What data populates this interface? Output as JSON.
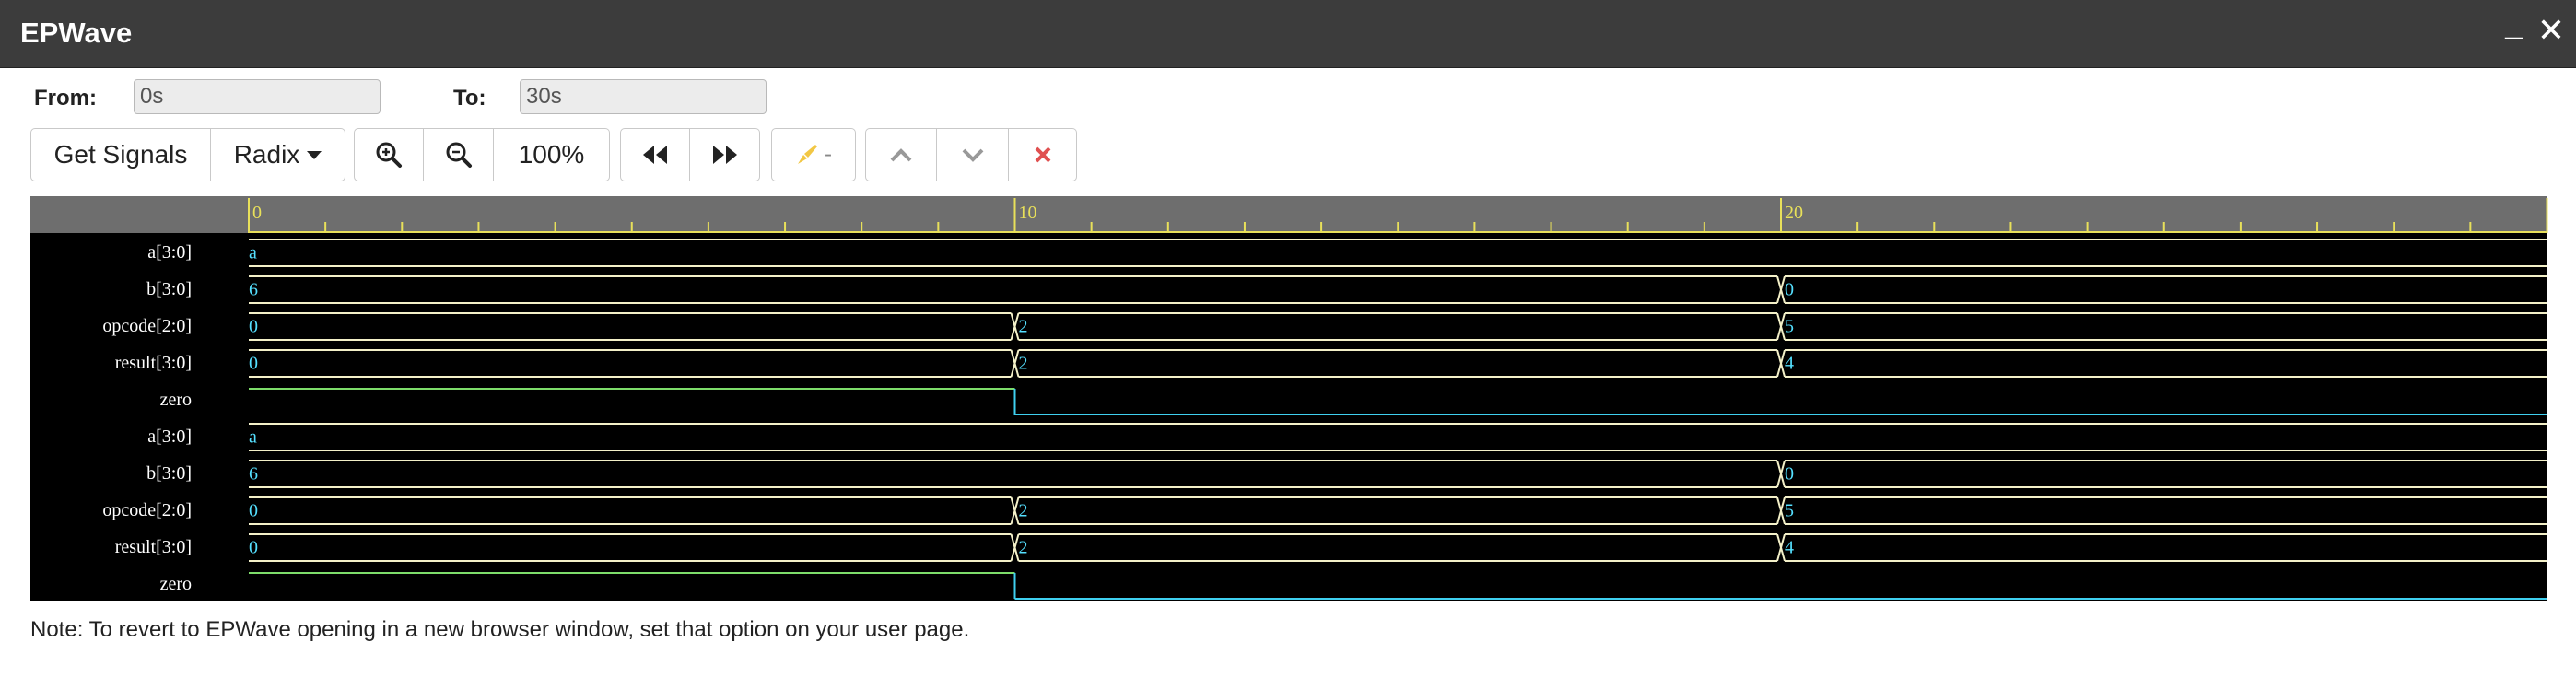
{
  "window": {
    "title": "EPWave",
    "minimize_glyph": "_",
    "close_glyph": "✕"
  },
  "range": {
    "from_label": "From:",
    "from_value": "0s",
    "to_label": "To:",
    "to_value": "30s"
  },
  "toolbar": {
    "get_signals_label": "Get Signals",
    "radix_label": "Radix",
    "zoom_level": "100%",
    "highlight_label": "-"
  },
  "ruler": {
    "labels": [
      "0",
      "10",
      "20"
    ]
  },
  "signals": [
    {
      "name": "a[3:0]",
      "type": "bus",
      "segments": [
        {
          "t0": 0,
          "t1": 30,
          "v": "a"
        }
      ]
    },
    {
      "name": "b[3:0]",
      "type": "bus",
      "segments": [
        {
          "t0": 0,
          "t1": 20,
          "v": "6"
        },
        {
          "t0": 20,
          "t1": 30,
          "v": "0"
        }
      ]
    },
    {
      "name": "opcode[2:0]",
      "type": "bus",
      "segments": [
        {
          "t0": 0,
          "t1": 10,
          "v": "0"
        },
        {
          "t0": 10,
          "t1": 20,
          "v": "2"
        },
        {
          "t0": 20,
          "t1": 30,
          "v": "5"
        }
      ]
    },
    {
      "name": "result[3:0]",
      "type": "bus",
      "segments": [
        {
          "t0": 0,
          "t1": 10,
          "v": "0"
        },
        {
          "t0": 10,
          "t1": 20,
          "v": "2"
        },
        {
          "t0": 20,
          "t1": 30,
          "v": "4"
        }
      ]
    },
    {
      "name": "zero",
      "type": "bit",
      "transitions": [
        {
          "t": 0,
          "v": 1
        },
        {
          "t": 10,
          "v": 0
        }
      ]
    },
    {
      "name": "a[3:0]",
      "type": "bus",
      "segments": [
        {
          "t0": 0,
          "t1": 30,
          "v": "a"
        }
      ]
    },
    {
      "name": "b[3:0]",
      "type": "bus",
      "segments": [
        {
          "t0": 0,
          "t1": 20,
          "v": "6"
        },
        {
          "t0": 20,
          "t1": 30,
          "v": "0"
        }
      ]
    },
    {
      "name": "opcode[2:0]",
      "type": "bus",
      "segments": [
        {
          "t0": 0,
          "t1": 10,
          "v": "0"
        },
        {
          "t0": 10,
          "t1": 20,
          "v": "2"
        },
        {
          "t0": 20,
          "t1": 30,
          "v": "5"
        }
      ]
    },
    {
      "name": "result[3:0]",
      "type": "bus",
      "segments": [
        {
          "t0": 0,
          "t1": 10,
          "v": "0"
        },
        {
          "t0": 10,
          "t1": 20,
          "v": "2"
        },
        {
          "t0": 20,
          "t1": 30,
          "v": "4"
        }
      ]
    },
    {
      "name": "zero",
      "type": "bit",
      "transitions": [
        {
          "t": 0,
          "v": 1
        },
        {
          "t": 10,
          "v": 0
        }
      ]
    }
  ],
  "timeline": {
    "start": 0,
    "end": 30,
    "unit": "s"
  },
  "colors": {
    "ruler_text": "#e8e05a",
    "bus_line": "#f3f0c8",
    "bus_value": "#55e0ff",
    "bit_high": "#7ddc6a",
    "bit_low": "#3fd0f0",
    "highlight_icon": "#f2c744",
    "clear_icon": "#e05050"
  },
  "icons": {
    "zoom_in": "zoom-in-icon",
    "zoom_out": "zoom-out-icon",
    "prev": "fast-backward-icon",
    "next": "fast-forward-icon",
    "highlight": "highlighter-icon",
    "up": "chevron-up-icon",
    "down": "chevron-down-icon",
    "clear": "x-icon"
  },
  "note": "Note: To revert to EPWave opening in a new browser window, set that option on your user page."
}
